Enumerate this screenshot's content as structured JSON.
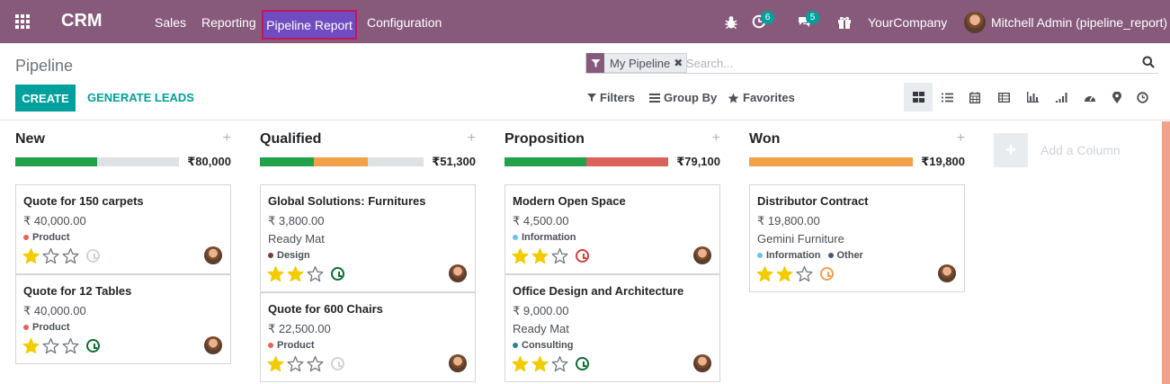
{
  "navbar": {
    "app_name": "CRM",
    "menu": [
      "Sales",
      "Reporting",
      "Pipeline Report",
      "Configuration"
    ],
    "activities_count": "6",
    "messages_count": "5",
    "company": "YourCompany",
    "user": "Mitchell Admin (pipeline_report)"
  },
  "control_panel": {
    "title": "Pipeline",
    "facet": "My Pipeline",
    "search_placeholder": "Search...",
    "create": "CREATE",
    "generate_leads": "GENERATE LEADS",
    "filters": "Filters",
    "group_by": "Group By",
    "favorites": "Favorites",
    "views": [
      "kanban",
      "list",
      "calendar",
      "pivot",
      "graph",
      "cohort",
      "dashboard",
      "map",
      "activity"
    ]
  },
  "colors": {
    "brand": "#875a7b",
    "accent": "#00a09d",
    "green": "#21a24a",
    "orange": "#f0a14a",
    "red": "#d9625b",
    "grey": "#dee2e6"
  },
  "columns": [
    {
      "name": "New",
      "total": "₹80,000",
      "progress": [
        {
          "color": "green",
          "pct": 50
        },
        {
          "color": "grey",
          "pct": 50
        }
      ],
      "cards": [
        {
          "title": "Quote for 150 carpets",
          "amount": "₹ 40,000.00",
          "company": "",
          "tags": [
            {
              "label": "Product",
              "color": "#e8625a"
            }
          ],
          "stars": 1,
          "activity": "none"
        },
        {
          "title": "Quote for 12 Tables",
          "amount": "₹ 40,000.00",
          "company": "",
          "tags": [
            {
              "label": "Product",
              "color": "#e8625a"
            }
          ],
          "stars": 1,
          "activity": "planned"
        }
      ]
    },
    {
      "name": "Qualified",
      "total": "₹51,300",
      "progress": [
        {
          "color": "green",
          "pct": 33
        },
        {
          "color": "orange",
          "pct": 33
        },
        {
          "color": "grey",
          "pct": 34
        }
      ],
      "cards": [
        {
          "title": "Global Solutions: Furnitures",
          "amount": "₹ 3,800.00",
          "company": "Ready Mat",
          "tags": [
            {
              "label": "Design",
              "color": "#7a3b3b"
            }
          ],
          "stars": 2,
          "activity": "planned"
        },
        {
          "title": "Quote for 600 Chairs",
          "amount": "₹ 22,500.00",
          "company": "",
          "tags": [
            {
              "label": "Product",
              "color": "#e8625a"
            }
          ],
          "stars": 1,
          "activity": "none"
        }
      ]
    },
    {
      "name": "Proposition",
      "total": "₹79,100",
      "progress": [
        {
          "color": "green",
          "pct": 50
        },
        {
          "color": "red",
          "pct": 50
        }
      ],
      "cards": [
        {
          "title": "Modern Open Space",
          "amount": "₹ 4,500.00",
          "company": "",
          "tags": [
            {
              "label": "Information",
              "color": "#6cc1ed"
            }
          ],
          "stars": 2,
          "activity": "overdue"
        },
        {
          "title": "Office Design and Architecture",
          "amount": "₹ 9,000.00",
          "company": "Ready Mat",
          "tags": [
            {
              "label": "Consulting",
              "color": "#2c8397"
            }
          ],
          "stars": 2,
          "activity": "planned"
        }
      ]
    },
    {
      "name": "Won",
      "total": "₹19,800",
      "progress": [
        {
          "color": "orange",
          "pct": 100
        }
      ],
      "cards": [
        {
          "title": "Distributor Contract",
          "amount": "₹ 19,800.00",
          "company": "Gemini Furniture",
          "tags": [
            {
              "label": "Information",
              "color": "#6cc1ed"
            },
            {
              "label": "Other",
              "color": "#475577"
            }
          ],
          "stars": 2,
          "activity": "today"
        }
      ]
    }
  ],
  "add_column": "Add a Column"
}
